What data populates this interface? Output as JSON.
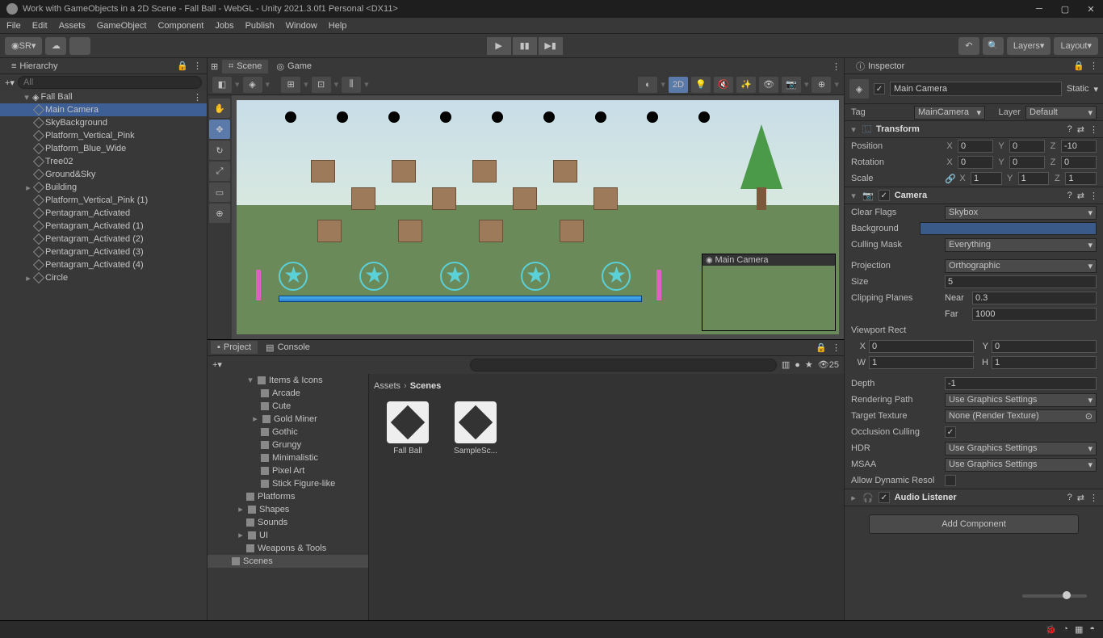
{
  "titlebar": {
    "title": "Work with GameObjects in a 2D Scene - Fall Ball - WebGL - Unity 2021.3.0f1 Personal <DX11>"
  },
  "menu": {
    "file": "File",
    "edit": "Edit",
    "assets": "Assets",
    "gameobject": "GameObject",
    "component": "Component",
    "jobs": "Jobs",
    "publish": "Publish",
    "window": "Window",
    "help": "Help"
  },
  "toolbar": {
    "account": "SR",
    "layers": "Layers",
    "layout": "Layout"
  },
  "hierarchy": {
    "title": "Hierarchy",
    "search_placeholder": "All",
    "root": "Fall Ball",
    "items": [
      "Main Camera",
      "SkyBackground",
      "Platform_Vertical_Pink",
      "Platform_Blue_Wide",
      "Tree02",
      "Ground&Sky",
      "Building",
      "Platform_Vertical_Pink (1)",
      "Pentagram_Activated",
      "Pentagram_Activated (1)",
      "Pentagram_Activated (2)",
      "Pentagram_Activated (3)",
      "Pentagram_Activated (4)",
      "Circle"
    ]
  },
  "scene": {
    "tab_scene": "Scene",
    "tab_game": "Game",
    "btn_2d": "2D",
    "camera_preview": "Main Camera"
  },
  "project": {
    "tab_project": "Project",
    "tab_console": "Console",
    "hidden_count": "25",
    "breadcrumb_root": "Assets",
    "breadcrumb_current": "Scenes",
    "folders": [
      "Items & Icons",
      "Arcade",
      "Cute",
      "Gold Miner",
      "Gothic",
      "Grungy",
      "Minimalistic",
      "Pixel Art",
      "Stick Figure-like",
      "Platforms",
      "Shapes",
      "Sounds",
      "UI",
      "Weapons & Tools",
      "Scenes"
    ],
    "assets": [
      {
        "name": "Fall Ball"
      },
      {
        "name": "SampleSc..."
      }
    ]
  },
  "inspector": {
    "title": "Inspector",
    "static": "Static",
    "object_name": "Main Camera",
    "tag_label": "Tag",
    "tag_value": "MainCamera",
    "layer_label": "Layer",
    "layer_value": "Default",
    "transform": {
      "title": "Transform",
      "position": "Position",
      "px": "0",
      "py": "0",
      "pz": "-10",
      "rotation": "Rotation",
      "rx": "0",
      "ry": "0",
      "rz": "0",
      "scale": "Scale",
      "sx": "1",
      "sy": "1",
      "sz": "1"
    },
    "camera": {
      "title": "Camera",
      "clear_flags": "Clear Flags",
      "clear_flags_v": "Skybox",
      "background": "Background",
      "culling_mask": "Culling Mask",
      "culling_mask_v": "Everything",
      "projection": "Projection",
      "projection_v": "Orthographic",
      "size": "Size",
      "size_v": "5",
      "clipping": "Clipping Planes",
      "near": "Near",
      "near_v": "0.3",
      "far": "Far",
      "far_v": "1000",
      "viewport": "Viewport Rect",
      "vx": "0",
      "vy": "0",
      "vw": "1",
      "vh": "1",
      "depth": "Depth",
      "depth_v": "-1",
      "rendering_path": "Rendering Path",
      "rendering_path_v": "Use Graphics Settings",
      "target_texture": "Target Texture",
      "target_texture_v": "None (Render Texture)",
      "occlusion": "Occlusion Culling",
      "hdr": "HDR",
      "hdr_v": "Use Graphics Settings",
      "msaa": "MSAA",
      "msaa_v": "Use Graphics Settings",
      "dynres": "Allow Dynamic Resol"
    },
    "audio": {
      "title": "Audio Listener"
    },
    "add_component": "Add Component"
  }
}
